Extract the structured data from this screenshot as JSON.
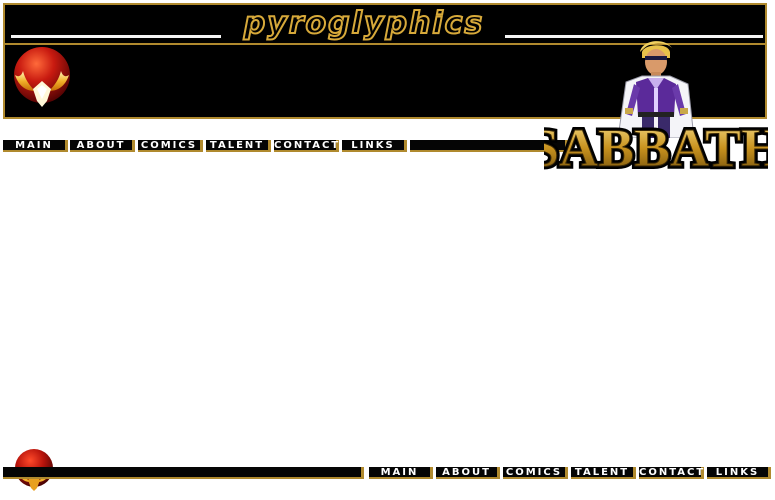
{
  "header": {
    "site_title": "pyroglyphics",
    "logo_icon": "phoenix-logo-icon",
    "character_icon": "hero-character-illustration",
    "comic_logo_text": "SABBATH"
  },
  "top_nav": {
    "items": [
      {
        "label": "MAIN"
      },
      {
        "label": "ABOUT"
      },
      {
        "label": "COMICS"
      },
      {
        "label": "TALENT"
      },
      {
        "label": "CONTACT"
      },
      {
        "label": "LINKS"
      }
    ]
  },
  "bottom_nav": {
    "items": [
      {
        "label": "MAIN"
      },
      {
        "label": "ABOUT"
      },
      {
        "label": "COMICS"
      },
      {
        "label": "TALENT"
      },
      {
        "label": "CONTACT"
      },
      {
        "label": "LINKS"
      }
    ]
  },
  "colors": {
    "gold": "#b08a2e",
    "background": "#ffffff",
    "bar": "#050505"
  }
}
